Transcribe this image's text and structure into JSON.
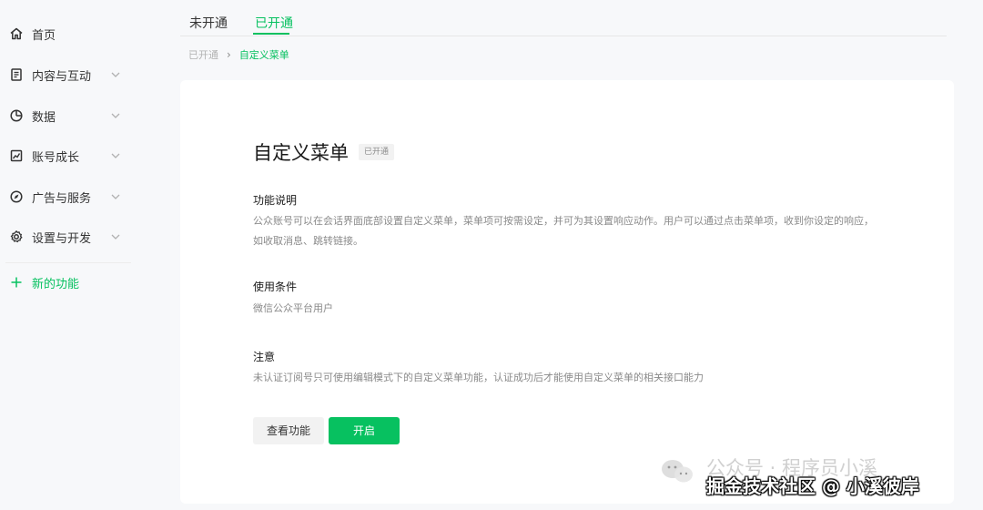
{
  "sidebar": {
    "items": [
      {
        "label": "首页",
        "icon": "home-icon"
      },
      {
        "label": "内容与互动",
        "icon": "document-icon"
      },
      {
        "label": "数据",
        "icon": "pie-chart-icon"
      },
      {
        "label": "账号成长",
        "icon": "trend-icon"
      },
      {
        "label": "广告与服务",
        "icon": "compass-icon"
      },
      {
        "label": "设置与开发",
        "icon": "gear-icon"
      }
    ],
    "new_feature": {
      "label": "新的功能",
      "icon": "plus-icon"
    }
  },
  "tabs": [
    {
      "label": "未开通",
      "active": false
    },
    {
      "label": "已开通",
      "active": true
    }
  ],
  "breadcrumb": {
    "parent": "已开通",
    "separator": "›",
    "current": "自定义菜单"
  },
  "feature": {
    "title": "自定义菜单",
    "status_badge": "已开通",
    "sections": [
      {
        "heading": "功能说明",
        "body": "公众账号可以在会话界面底部设置自定义菜单，菜单项可按需设定，并可为其设置响应动作。用户可以通过点击菜单项，收到你设定的响应，如收取消息、跳转链接。"
      },
      {
        "heading": "使用条件",
        "body": "微信公众平台用户"
      },
      {
        "heading": "注意",
        "body": "未认证订阅号只可使用编辑模式下的自定义菜单功能，认证成功后才能使用自定义菜单的相关接口能力"
      }
    ],
    "buttons": {
      "view": "查看功能",
      "open": "开启"
    }
  },
  "watermark": {
    "line1": "公众号 · 程序员小溪",
    "line2": "掘金技术社区 @ 小溪彼岸"
  },
  "colors": {
    "accent": "#07c160",
    "background": "#f7f8fa",
    "card": "#ffffff"
  }
}
